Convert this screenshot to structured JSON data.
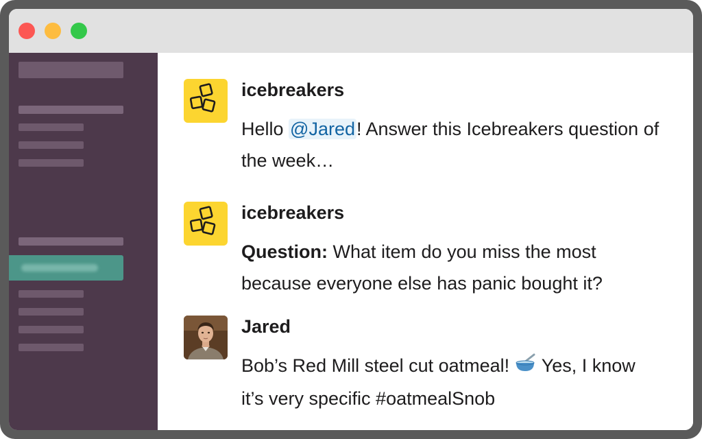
{
  "window": {
    "buttons": [
      "close",
      "minimize",
      "maximize"
    ]
  },
  "sidebar": {
    "active_channel": "# icebreakers"
  },
  "messages": [
    {
      "sender": "icebreakers",
      "avatar_icon": "ice-cubes-icon",
      "greeting": "Hello ",
      "mention": "@Jared",
      "text": "! Answer this Icebreakers question of the week…"
    },
    {
      "sender": "icebreakers",
      "avatar_icon": "ice-cubes-icon",
      "label": "Question:",
      "text": " What item do you miss the most because everyone else has panic bought it?"
    },
    {
      "sender": "Jared",
      "avatar_icon": "user-photo",
      "text_before": "Bob’s Red Mill steel cut oatmeal! ",
      "emoji": "bowl-with-spoon",
      "text_after": " Yes, I know it’s very specific #oatmealSnob"
    }
  ],
  "colors": {
    "sidebar": "#4d394b",
    "active_channel": "#4c9689",
    "mention": "#1264a3",
    "bot_avatar": "#fcd530"
  }
}
